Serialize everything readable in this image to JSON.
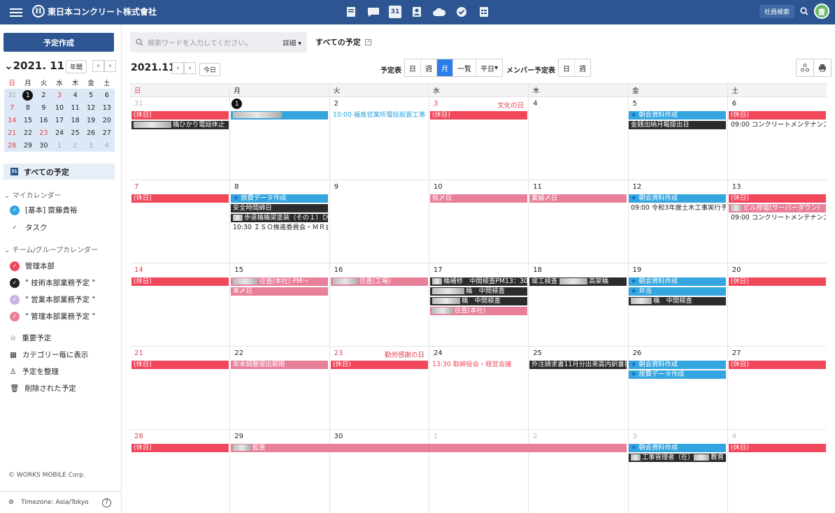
{
  "header": {
    "company": "東日本コンクリート株式會社",
    "calendar_icon_text": "31",
    "employee_search": "社員検索",
    "avatar": "齋"
  },
  "sidebar": {
    "create": "予定作成",
    "mini_month": "2021. 11",
    "year_btn": "年間",
    "weekdays": [
      "日",
      "月",
      "火",
      "水",
      "木",
      "金",
      "土"
    ],
    "weeks": [
      [
        "31",
        "1",
        "2",
        "3",
        "4",
        "5",
        "6"
      ],
      [
        "7",
        "8",
        "9",
        "10",
        "11",
        "12",
        "13"
      ],
      [
        "14",
        "15",
        "16",
        "17",
        "18",
        "19",
        "20"
      ],
      [
        "21",
        "22",
        "23",
        "24",
        "25",
        "26",
        "27"
      ],
      [
        "28",
        "29",
        "30",
        "1",
        "2",
        "3",
        "4"
      ]
    ],
    "all_schedules": "すべての予定",
    "my_cal_title": "マイカレンダー",
    "my_cal": [
      "[基本] 齋藤貴裕",
      "タスク"
    ],
    "team_title": "チーム/グループカレンダー",
    "team": [
      "管理本部",
      "\" 技術本部業務予定 \"",
      "\" 営業本部業務予定 \"",
      "\" 管理本部業務予定 \""
    ],
    "tools": [
      "重要予定",
      "カテゴリー毎に表示",
      "予定を整理",
      "削除された予定"
    ],
    "copyright": "© WORKS MOBILE Corp.",
    "timezone": "Timezone: Asia/Tokyo"
  },
  "toolbar": {
    "search_placeholder": "検索ワードを入力してください。",
    "detail": "詳細",
    "all_title": "すべての予定",
    "month": "2021.11",
    "today": "今日",
    "schedule_label": "予定表",
    "views": [
      "日",
      "週",
      "月",
      "一覧",
      "平日"
    ],
    "member_label": "メンバー予定表",
    "member_views": [
      "日",
      "週"
    ]
  },
  "calendar": {
    "dow": [
      "日",
      "月",
      "火",
      "水",
      "木",
      "金",
      "土"
    ],
    "weeks": [
      {
        "days": [
          "31",
          "1",
          "2",
          "3",
          "4",
          "5",
          "6"
        ],
        "holidays": {
          "3": "文化の日"
        }
      },
      {
        "days": [
          "7",
          "8",
          "9",
          "10",
          "11",
          "12",
          "13"
        ]
      },
      {
        "days": [
          "14",
          "15",
          "16",
          "17",
          "18",
          "19",
          "20"
        ]
      },
      {
        "days": [
          "21",
          "22",
          "23",
          "24",
          "25",
          "26",
          "27"
        ],
        "holidays": {
          "2": "勤労感謝の日"
        }
      },
      {
        "days": [
          "28",
          "29",
          "30",
          "1",
          "2",
          "3",
          "4"
        ]
      }
    ],
    "events": {
      "w1": {
        "sun1": "(休日)",
        "sun2": "橋ひかり電話休止",
        "tue1": "10:00 福島営業所電話設置工事",
        "wed1": "(休日)",
        "fri1": "朝会資料作成",
        "fri2": "金銭出納月報提出日",
        "sat1": "(休日)",
        "sat2": "09:00 コンクリートメンテナンス協"
      },
      "w2": {
        "sun1": "(休日)",
        "mon1": "旅費データ作成",
        "mon2": "安全時間締日",
        "mon3": "歩道橋橋梁塗装（その１）ひか",
        "mon4": "10:30 ＩＳＯ推進委員会・ＭＲ会議",
        "wed1": "仮〆日",
        "thu1": "業績〆日",
        "fri1": "朝会資料作成",
        "fri2": "09:00 令和3年度土木工事実行予算",
        "sat1": "(休日)",
        "sat2": "ビル停電(サーバーダウン)",
        "sat3": "09:00 コンクリートメンテナンス協"
      },
      "w3": {
        "sun1": "(休日)",
        "mon1": "往査(本社) PM～",
        "mon2": "本〆日",
        "tue1": "往査(工場)",
        "wed1": "橋補修　中間検査PM13：30～",
        "wed2": "橋　中間検査",
        "wed3": "橋　中間検査",
        "wed4": "往査(本社)",
        "thu1": "竣工検査",
        "thu2": "高架橋",
        "fri1": "朝会資料作成",
        "fri2": "弁当",
        "fri3": "橋　中間検査",
        "sat1": "(休日)"
      },
      "w4": {
        "sun1": "(休日)",
        "mon1": "年末調整提出期限",
        "tue1": "(休日)",
        "wed1": "13:30 取締役会・経営会議",
        "thu1": "外注請求書11月分出来高内訳書提出",
        "fri1": "朝会資料作成",
        "fri2": "旅費データ作成",
        "sat1": "(休日)"
      },
      "w5": {
        "sun1": "(休日)",
        "mon1": "監査",
        "fri1": "朝会資料作成",
        "fri2": "工事管理者（在）",
        "fri3": "教育（雄",
        "sat1": "(休日)"
      }
    }
  },
  "colors": {
    "header": "#2d5591",
    "holiday": "#f1475b",
    "pink": "#e9809a",
    "blue": "#35a5df",
    "dark": "#2c2c2c",
    "active": "#2b7de9"
  }
}
